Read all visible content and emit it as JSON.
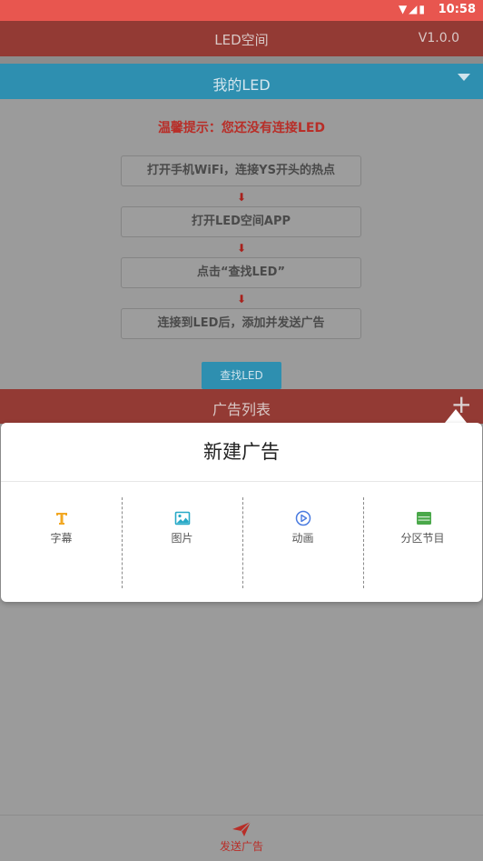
{
  "status_bar": {
    "time": "10:58",
    "signal_icons": "▼◢▮"
  },
  "app_bar": {
    "title": "LED空间",
    "version": "V1.0.0"
  },
  "led_bar": {
    "title": "我的LED"
  },
  "tip": "温馨提示：您还没有连接LED",
  "steps": [
    "打开手机WiFi，连接YS开头的热点",
    "打开LED空间APP",
    "点击“查找LED”",
    "连接到LED后，添加并发送广告"
  ],
  "arrow_glyph": "⬇",
  "find_button": "查找LED",
  "list_bar": {
    "title": "广告列表",
    "plus": "+"
  },
  "popup": {
    "title": "新建广告",
    "options": [
      {
        "label": "字幕",
        "icon": "text-t-icon",
        "color": "#f2a824"
      },
      {
        "label": "图片",
        "icon": "image-icon",
        "color": "#27a9c7"
      },
      {
        "label": "动画",
        "icon": "play-circle-icon",
        "color": "#4a7be0"
      },
      {
        "label": "分区节目",
        "icon": "partition-icon",
        "color": "#4aa84a"
      }
    ]
  },
  "bottom_bar": {
    "label": "发送广告",
    "icon": "send-plane-icon"
  }
}
